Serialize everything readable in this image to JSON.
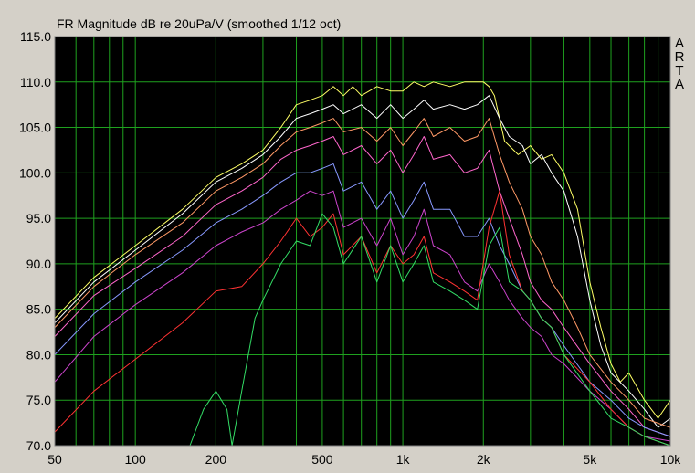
{
  "header": {
    "title": "FR Magnitude dB re 20uPa/V (smoothed 1/12 oct)"
  },
  "watermark": {
    "letters": [
      "A",
      "R",
      "T",
      "A"
    ]
  },
  "chart_data": {
    "type": "line",
    "title": "FR Magnitude dB re 20uPa/V (smoothed 1/12 oct)",
    "xlabel": "",
    "ylabel": "",
    "x_scale": "log",
    "xlim": [
      50,
      10000
    ],
    "ylim": [
      70,
      115
    ],
    "grid": true,
    "background": "#000000",
    "grid_color": "#1fa11f",
    "x_ticks": [
      50,
      100,
      200,
      500,
      1000,
      2000,
      5000,
      10000
    ],
    "x_tick_labels": [
      "50",
      "100",
      "200",
      "500",
      "1k",
      "2k",
      "5k",
      "10k"
    ],
    "y_ticks": [
      70,
      75,
      80,
      85,
      90,
      95,
      100,
      105,
      110,
      115
    ],
    "y_tick_labels": [
      "70.0",
      "75.0",
      "80.0",
      "85.0",
      "90.0",
      "95.0",
      "100.0",
      "105.0",
      "110.0",
      "115.0"
    ],
    "series": [
      {
        "color": "#ffff66",
        "x": [
          50,
          70,
          100,
          150,
          200,
          250,
          300,
          350,
          400,
          450,
          500,
          550,
          600,
          650,
          700,
          800,
          900,
          1000,
          1100,
          1200,
          1300,
          1500,
          1700,
          1900,
          2000,
          2100,
          2200,
          2400,
          2700,
          3000,
          3300,
          3600,
          4000,
          4500,
          5000,
          5500,
          6000,
          6500,
          7000,
          8000,
          9000,
          10000
        ],
        "y": [
          84,
          88.5,
          92,
          96,
          99.5,
          101,
          102.5,
          105,
          107.5,
          108,
          108.5,
          109.5,
          108.5,
          109.5,
          108.5,
          109.5,
          109,
          109,
          110,
          109.5,
          110,
          109.5,
          110,
          110,
          110,
          109.5,
          108.5,
          103.5,
          102,
          103,
          101.5,
          102,
          100,
          96,
          88,
          83,
          79,
          77,
          78,
          75,
          73,
          75
        ]
      },
      {
        "color": "#ffffff",
        "x": [
          50,
          70,
          100,
          150,
          200,
          250,
          300,
          350,
          400,
          450,
          500,
          550,
          600,
          700,
          800,
          900,
          1000,
          1100,
          1200,
          1300,
          1500,
          1700,
          1900,
          2100,
          2300,
          2500,
          2800,
          3000,
          3300,
          3600,
          4000,
          4500,
          5000,
          5500,
          6000,
          7000,
          8000,
          9000,
          10000
        ],
        "y": [
          83.5,
          88,
          91.5,
          95.5,
          99,
          100.5,
          102,
          104,
          106,
          106.5,
          107,
          107.5,
          106.5,
          107.5,
          106,
          107.5,
          106,
          107,
          108,
          107,
          107.5,
          107,
          107.5,
          108.5,
          106,
          104,
          103,
          101,
          102,
          100,
          98,
          93,
          86,
          81,
          78,
          76,
          74,
          72,
          73
        ]
      },
      {
        "color": "#ff9966",
        "x": [
          50,
          70,
          100,
          150,
          200,
          250,
          300,
          350,
          400,
          450,
          500,
          550,
          600,
          700,
          800,
          900,
          1000,
          1100,
          1200,
          1300,
          1500,
          1700,
          1900,
          2100,
          2300,
          2500,
          2800,
          3000,
          3300,
          3600,
          4000,
          4500,
          5000,
          6000,
          7000,
          8000,
          10000
        ],
        "y": [
          83,
          87.5,
          91,
          94.5,
          98,
          99.5,
          101,
          103,
          104.5,
          105,
          105.5,
          106,
          104.5,
          105,
          103.5,
          105,
          103,
          104.5,
          106,
          104,
          105,
          103.5,
          104,
          106,
          102,
          99,
          96,
          93,
          91,
          88,
          86,
          83,
          80,
          77,
          75,
          73,
          72
        ]
      },
      {
        "color": "#ff66cc",
        "x": [
          50,
          70,
          100,
          150,
          200,
          250,
          300,
          350,
          400,
          450,
          500,
          550,
          600,
          700,
          800,
          900,
          1000,
          1100,
          1200,
          1300,
          1500,
          1700,
          1900,
          2100,
          2300,
          2500,
          2800,
          3000,
          3300,
          3600,
          4000,
          5000,
          6000,
          7000,
          8000,
          10000
        ],
        "y": [
          82,
          86.5,
          89.5,
          93,
          96.5,
          98,
          99.5,
          101.5,
          102.5,
          103,
          103.5,
          104,
          102,
          103,
          101,
          102.5,
          100,
          102,
          104,
          101.5,
          102,
          100,
          100.5,
          102.5,
          98,
          95,
          91,
          88,
          86,
          85,
          83,
          79,
          76,
          74,
          72,
          71
        ]
      },
      {
        "color": "#8899ff",
        "x": [
          50,
          70,
          100,
          150,
          200,
          250,
          300,
          350,
          400,
          450,
          500,
          550,
          600,
          700,
          800,
          900,
          1000,
          1100,
          1200,
          1300,
          1500,
          1700,
          1900,
          2100,
          2300,
          2500,
          2800,
          3000,
          3300,
          3600,
          4000,
          5000,
          6000,
          7000,
          8000,
          10000
        ],
        "y": [
          80,
          84.5,
          88,
          91.5,
          94.5,
          96,
          97.5,
          99,
          100,
          100,
          100.5,
          101,
          98,
          99,
          96,
          98,
          95,
          97,
          99,
          96,
          96,
          93,
          93,
          95,
          92,
          90,
          87,
          86,
          84,
          83,
          81,
          77,
          75,
          73,
          72,
          71
        ]
      },
      {
        "color": "#cc44cc",
        "x": [
          50,
          70,
          100,
          150,
          200,
          250,
          300,
          350,
          400,
          450,
          500,
          550,
          600,
          700,
          800,
          900,
          1000,
          1100,
          1200,
          1300,
          1500,
          1700,
          1900,
          2100,
          2300,
          2500,
          2800,
          3000,
          3300,
          3600,
          4000,
          5000,
          6000,
          7000,
          8000,
          10000
        ],
        "y": [
          77,
          82,
          85.5,
          89,
          92,
          93.5,
          94.5,
          96,
          97,
          98,
          97.5,
          98,
          94,
          95,
          92,
          95,
          91,
          93,
          96,
          92,
          91,
          88,
          87,
          90,
          88,
          86,
          84,
          83,
          82,
          80,
          79,
          76,
          74,
          72,
          71,
          70.5
        ]
      },
      {
        "color": "#ff3333",
        "x": [
          50,
          70,
          100,
          150,
          200,
          250,
          300,
          350,
          400,
          450,
          500,
          550,
          600,
          700,
          800,
          900,
          1000,
          1100,
          1200,
          1300,
          1500,
          1700,
          1900,
          2100,
          2300,
          2500,
          2800,
          3000,
          3300,
          3600,
          4000,
          5000,
          6000,
          7000,
          8000,
          10000
        ],
        "y": [
          71.5,
          76,
          79.5,
          83.5,
          87,
          87.5,
          90,
          92.5,
          95,
          93,
          94,
          95.5,
          91,
          93,
          89,
          92,
          90,
          91,
          93,
          89,
          88,
          87,
          86,
          94,
          98,
          91,
          87,
          86,
          84,
          83,
          80,
          77,
          74,
          72,
          71,
          70
        ]
      },
      {
        "color": "#33dd66",
        "x": [
          160,
          180,
          200,
          220,
          230,
          250,
          280,
          300,
          350,
          400,
          450,
          500,
          550,
          600,
          700,
          800,
          900,
          1000,
          1100,
          1200,
          1300,
          1500,
          1700,
          1900,
          2100,
          2300,
          2500,
          2800,
          3000,
          3300,
          3600,
          4000,
          5000,
          6000,
          7000,
          8000,
          10000
        ],
        "y": [
          70,
          74,
          76,
          74,
          70,
          76,
          84,
          86,
          90,
          92.5,
          92,
          95.5,
          94,
          90,
          93,
          88,
          92,
          88,
          90,
          92,
          88,
          87,
          86,
          85,
          92,
          94,
          88,
          87,
          86,
          84,
          83,
          80,
          76,
          73,
          72,
          71,
          70
        ]
      }
    ]
  }
}
